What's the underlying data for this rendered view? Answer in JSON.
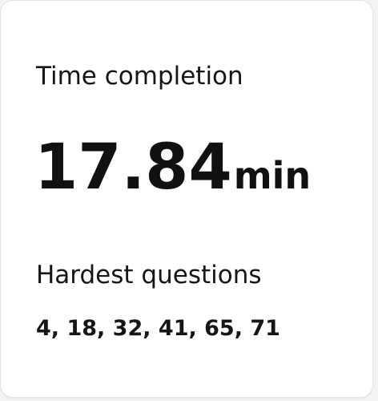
{
  "card": {
    "time_label": "Time completion",
    "time_value": "17.84",
    "time_unit": "min",
    "hardest_label": "Hardest questions",
    "hardest_questions": "4, 18, 32, 41, 65, 71"
  },
  "colors": {
    "background": "#f3f3f3",
    "card": "#ffffff",
    "text": "#111111"
  }
}
